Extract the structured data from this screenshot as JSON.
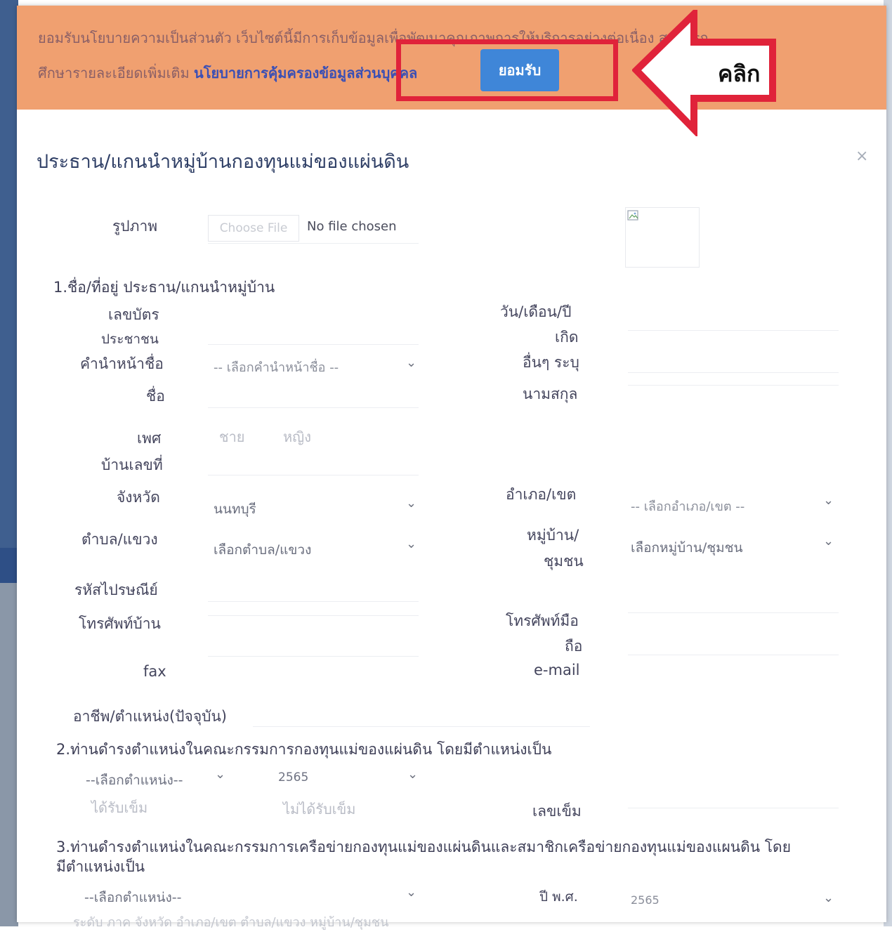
{
  "cookie_banner": {
    "line1": "ยอมรับนโยบายความเป็นส่วนตัว เว็บไซต์นี้มีการเก็บข้อมูลเพื่อพัฒนาคุณภาพการให้บริการอย่างต่อเนื่อง สามารถ",
    "line2_prefix": "ศึกษารายละเอียดเพิ่มเติม ",
    "policy_link": "นโยบายการคุ้มครองข้อมูลส่วนบุคคล",
    "accept_button": "ยอมรับ"
  },
  "annotation": {
    "arrow_label": "คลิก",
    "color": "#e0233a"
  },
  "modal": {
    "title": "ประธาน/แกนนำหมู่บ้านกองทุนแม่ของแผ่นดิน",
    "close": "×"
  },
  "photo": {
    "label": "รูปภาพ",
    "file_button": "Choose File",
    "file_status": "No file chosen"
  },
  "section1": {
    "heading": "1.ชื่อ/ที่อยู่ ประธาน/แกนนำหมู่บ้าน",
    "id_card_line1": "เลขบัตร",
    "id_card_line2": "ประชาชน",
    "dob_line1": "วัน/เดือน/ปี",
    "dob_line2": "เกิด",
    "other_specify": "อื่นๆ ระบุ",
    "prefix_label": "คำนำหน้าชื่อ",
    "prefix_placeholder": "-- เลือกคำนำหน้าชื่อ --",
    "first_name": "ชื่อ",
    "last_name": "นามสกุล",
    "gender_label": "เพศ",
    "gender_male": "ชาย",
    "gender_female": "หญิง",
    "house_no": "บ้านเลขที่",
    "province_label": "จังหวัด",
    "province_value": "นนทบุรี",
    "district_label": "อำเภอ/เขต",
    "district_placeholder": "-- เลือกอำเภอ/เขต --",
    "subdistrict_label": "ตำบล/แขวง",
    "subdistrict_placeholder": "เลือกตำบล/แขวง",
    "village_line1": "หมู่บ้าน/",
    "village_line2": "ชุมชน",
    "village_placeholder": "เลือกหมู่บ้าน/ชุมชน",
    "postcode": "รหัสไปรษณีย์",
    "home_phone": "โทรศัพท์บ้าน",
    "mobile_line1": "โทรศัพท์มือ",
    "mobile_line2": "ถือ",
    "fax": "fax",
    "email": "e-mail",
    "occupation": "อาชีพ/ตำแหน่ง(ปัจจุบัน)"
  },
  "section2": {
    "heading": "2.ท่านดำรงตำแหน่งในคณะกรรมการกองทุนแม่ของแผ่นดิน โดยมีตำแหน่งเป็น",
    "position_placeholder": "--เลือกตำแหน่ง--",
    "year_value": "2565",
    "received_pin": "ได้รับเข็ม",
    "not_received_pin": "ไม่ได้รับเข็ม",
    "pin_number": "เลขเข็ม"
  },
  "section3": {
    "heading_line1": "3.ท่านดำรงตำแหน่งในคณะกรรมการเครือข่ายกองทุนแม่ของแผ่นดินและสมาชิกเครือข่ายกองทุนแม่ของแผนดิน โดย",
    "heading_line2": "มีตำแหน่งเป็น",
    "position_placeholder": "--เลือกตำแหน่ง--",
    "year_label": "ปี พ.ศ.",
    "year_value": "2565",
    "partial_row": "ระดับ        ภาค        จังหวัด        อำเภอ/เขต        ตำบล/แขวง        หมู่บ้าน/ชุมชน"
  }
}
